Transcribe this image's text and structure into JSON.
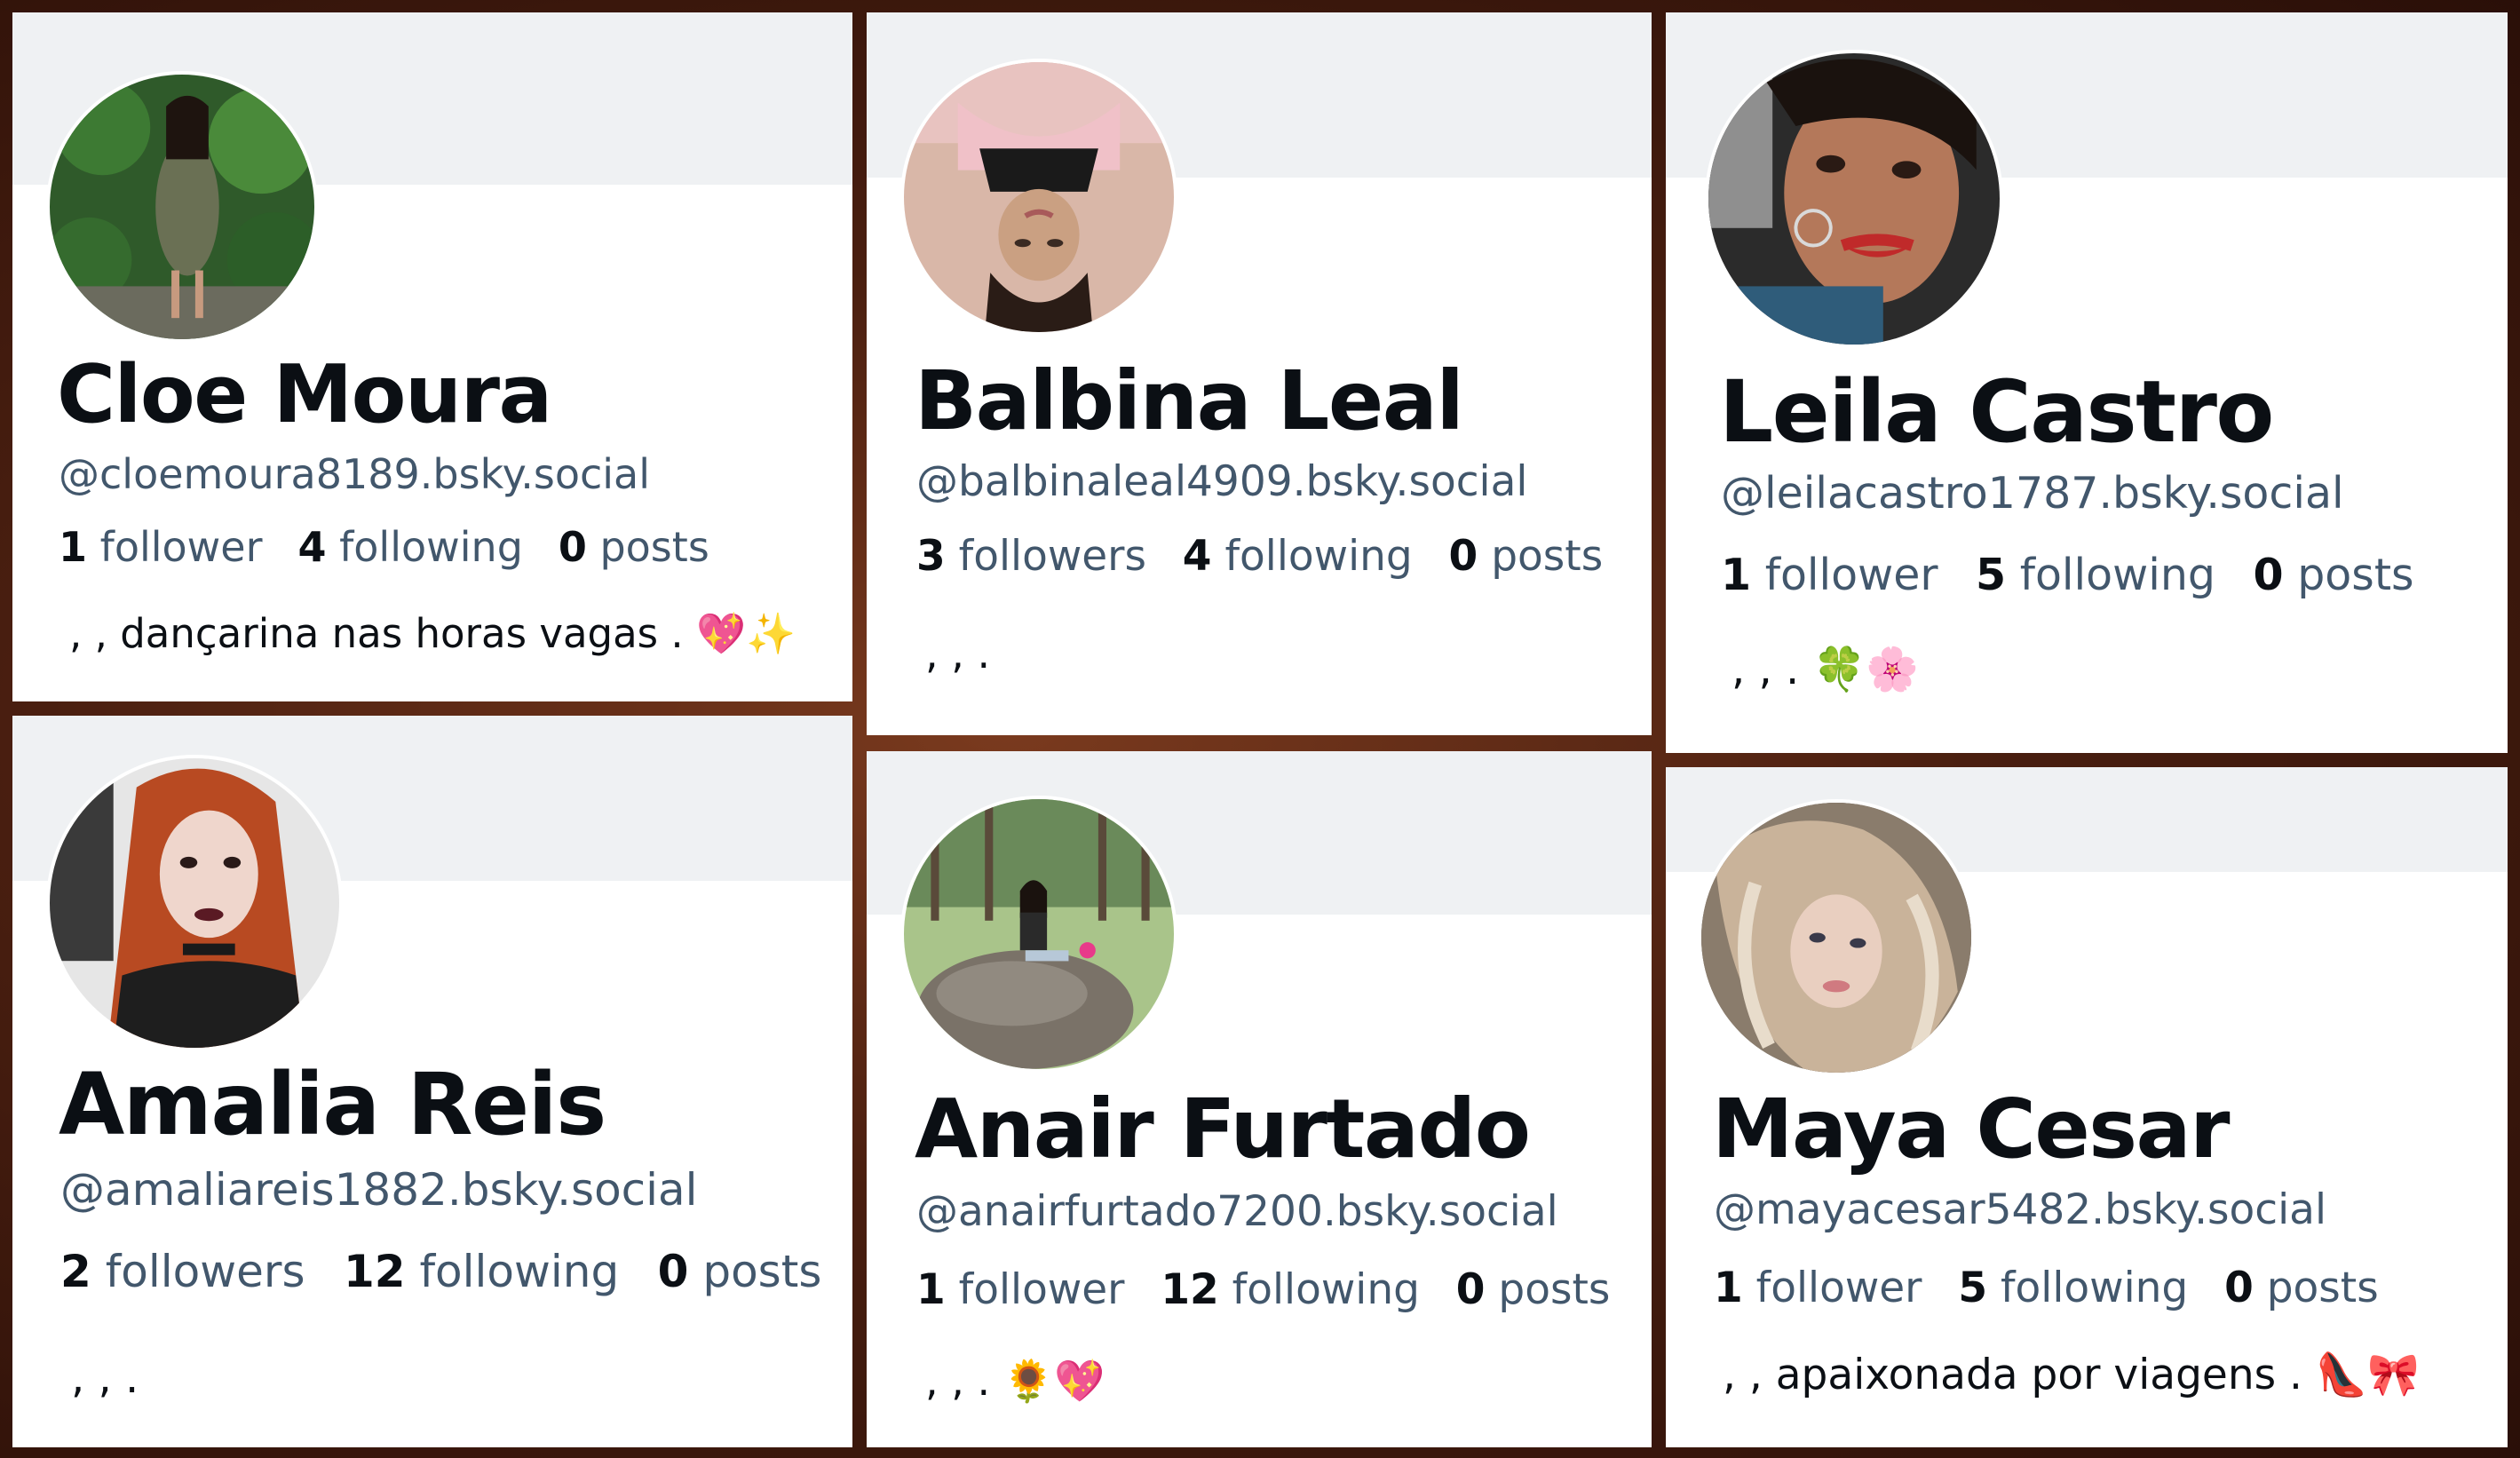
{
  "profiles": [
    {
      "display_name": "Cloe Moura",
      "handle": "@cloemoura8189.bsky.social",
      "followers_count": "1",
      "followers_label": "follower",
      "following_count": "4",
      "following_label": "following",
      "posts_count": "0",
      "posts_label": "posts",
      "bio": ", , dançarina nas horas vagas . 💖✨"
    },
    {
      "display_name": "Balbina Leal",
      "handle": "@balbinaleal4909.bsky.social",
      "followers_count": "3",
      "followers_label": "followers",
      "following_count": "4",
      "following_label": "following",
      "posts_count": "0",
      "posts_label": "posts",
      "bio": ", , ."
    },
    {
      "display_name": "Leila Castro",
      "handle": "@leilacastro1787.bsky.social",
      "followers_count": "1",
      "followers_label": "follower",
      "following_count": "5",
      "following_label": "following",
      "posts_count": "0",
      "posts_label": "posts",
      "bio": ", , . 🍀🌸"
    },
    {
      "display_name": "Amalia Reis",
      "handle": "@amaliareis1882.bsky.social",
      "followers_count": "2",
      "followers_label": "followers",
      "following_count": "12",
      "following_label": "following",
      "posts_count": "0",
      "posts_label": "posts",
      "bio": ", , ."
    },
    {
      "display_name": "Anair Furtado",
      "handle": "@anairfurtado7200.bsky.social",
      "followers_count": "1",
      "followers_label": "follower",
      "following_count": "12",
      "following_label": "following",
      "posts_count": "0",
      "posts_label": "posts",
      "bio": ", , . 🌻💖"
    },
    {
      "display_name": "Maya Cesar",
      "handle": "@mayacesar5482.bsky.social",
      "followers_count": "1",
      "followers_label": "follower",
      "following_count": "5",
      "following_label": "following",
      "posts_count": "0",
      "posts_label": "posts",
      "bio": ", , apaixonada por viagens . 👠🎀"
    }
  ]
}
